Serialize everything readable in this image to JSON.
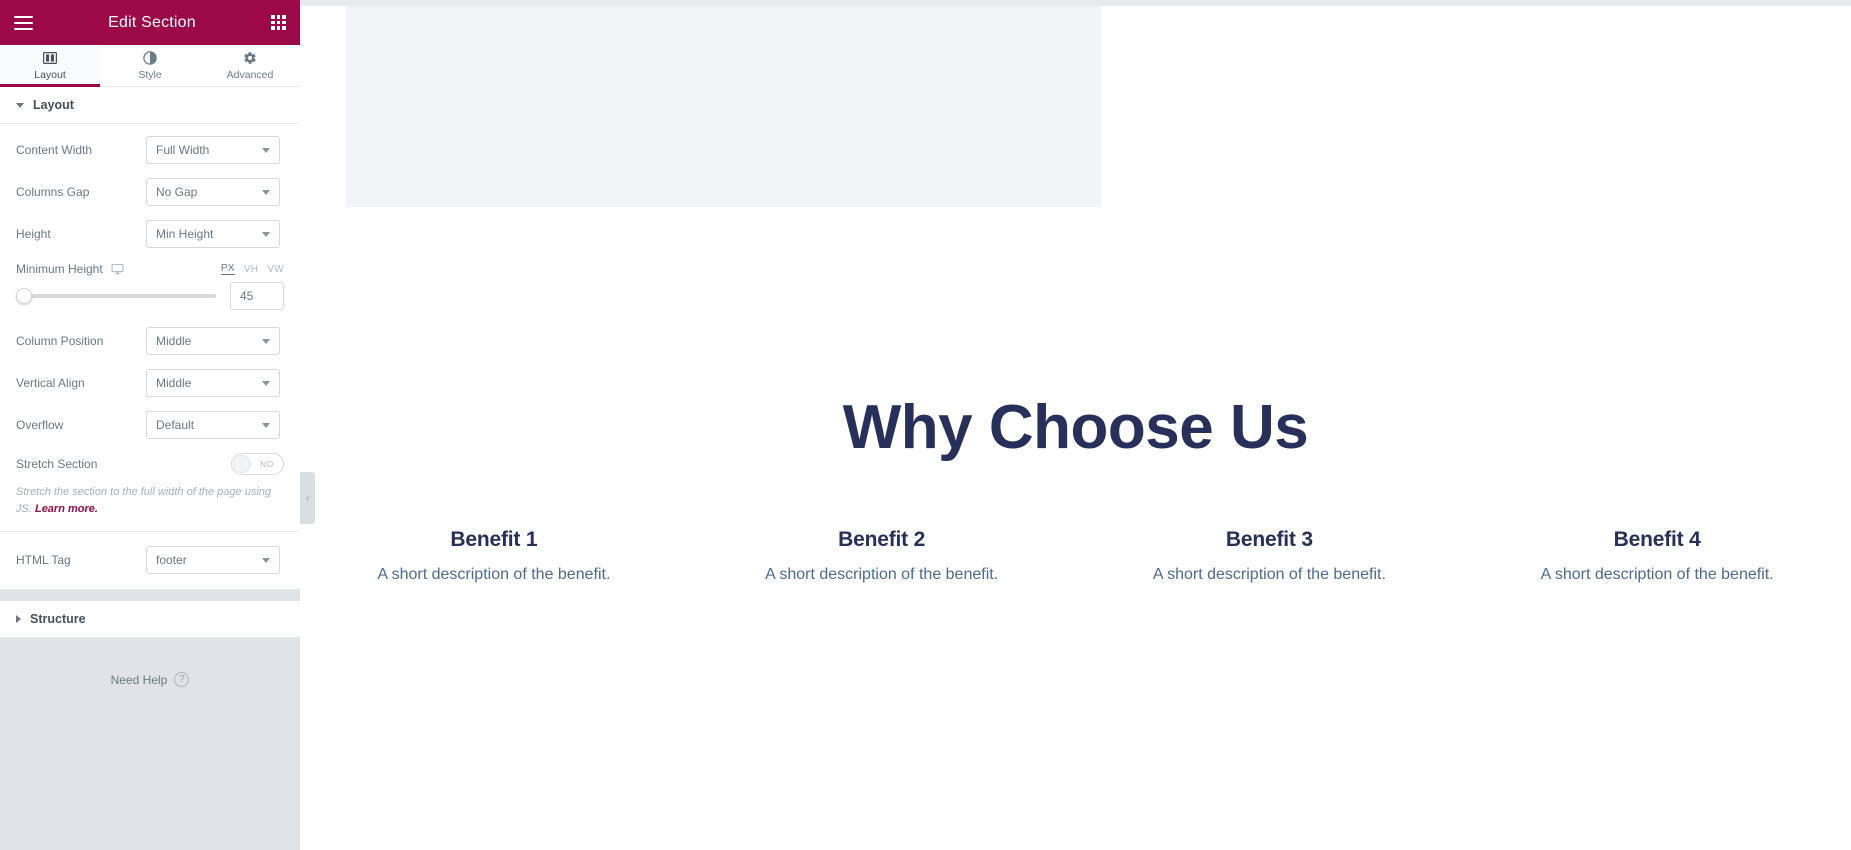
{
  "panel": {
    "header": {
      "title": "Edit Section",
      "menu_icon": "hamburger-icon",
      "grid_icon": "widgets-grid-icon",
      "bg_color": "#9b0a46"
    },
    "tabs": [
      {
        "label": "Layout",
        "icon": "columns-icon",
        "active": true
      },
      {
        "label": "Style",
        "icon": "contrast-icon",
        "active": false
      },
      {
        "label": "Advanced",
        "icon": "gear-icon",
        "active": false
      }
    ],
    "layout_section": {
      "title": "Layout",
      "expanded": true,
      "controls": {
        "content_width": {
          "label": "Content Width",
          "value": "Full Width"
        },
        "columns_gap": {
          "label": "Columns Gap",
          "value": "No Gap"
        },
        "height": {
          "label": "Height",
          "value": "Min Height"
        },
        "minimum_height": {
          "label": "Minimum Height",
          "device_icon": "desktop-icon",
          "units": [
            "PX",
            "VH",
            "VW"
          ],
          "active_unit": "PX",
          "value": "45",
          "slider_percent": 0
        },
        "column_position": {
          "label": "Column Position",
          "value": "Middle"
        },
        "vertical_align": {
          "label": "Vertical Align",
          "value": "Middle"
        },
        "overflow": {
          "label": "Overflow",
          "value": "Default"
        },
        "stretch_section": {
          "label": "Stretch Section",
          "toggle_state": "NO",
          "helper_text": "Stretch the section to the full width of the page using JS.",
          "helper_link": "Learn more."
        },
        "html_tag": {
          "label": "HTML Tag",
          "value": "footer"
        }
      }
    },
    "structure_section": {
      "title": "Structure",
      "expanded": false
    },
    "need_help": {
      "label": "Need Help",
      "icon": "question-circle-icon"
    },
    "collapse_handle": {
      "icon": "chevron-left-icon",
      "glyph": "‹"
    }
  },
  "canvas": {
    "hero": {
      "title": "Why Choose Us"
    },
    "benefits": [
      {
        "title": "Benefit 1",
        "description": "A short description of the benefit."
      },
      {
        "title": "Benefit 2",
        "description": "A short description of the benefit."
      },
      {
        "title": "Benefit 3",
        "description": "A short description of the benefit."
      },
      {
        "title": "Benefit 4",
        "description": "A short description of the benefit."
      }
    ],
    "colors": {
      "heading": "#27305a",
      "body": "#4f6b93",
      "placeholder_block": "#f2f4f8"
    }
  }
}
